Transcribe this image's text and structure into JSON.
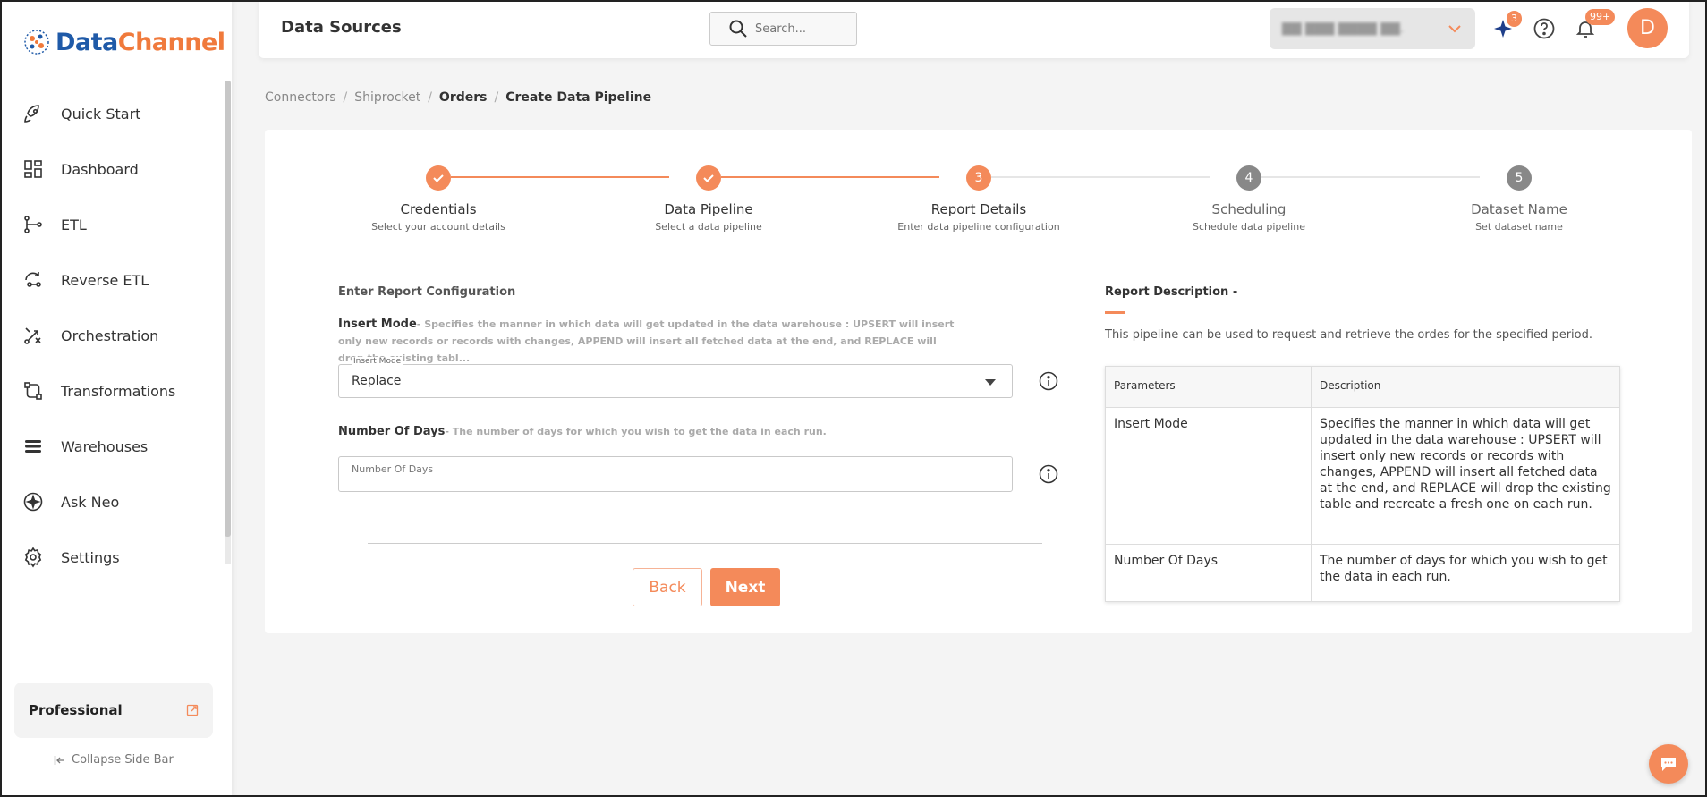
{
  "brand": {
    "name_part1": "Data",
    "name_part2": "Channel"
  },
  "sidebar": {
    "items": [
      {
        "label": "Quick Start",
        "icon": "rocket-icon"
      },
      {
        "label": "Dashboard",
        "icon": "dashboard-icon"
      },
      {
        "label": "ETL",
        "icon": "etl-icon"
      },
      {
        "label": "Reverse ETL",
        "icon": "reverse-etl-icon"
      },
      {
        "label": "Orchestration",
        "icon": "orchestration-icon"
      },
      {
        "label": "Transformations",
        "icon": "transformations-icon"
      },
      {
        "label": "Warehouses",
        "icon": "warehouses-icon"
      },
      {
        "label": "Ask Neo",
        "icon": "sparkle-icon"
      },
      {
        "label": "Settings",
        "icon": "gear-icon"
      }
    ],
    "plan_label": "Professional",
    "collapse_label": "Collapse Side Bar"
  },
  "header": {
    "title": "Data Sources",
    "search_placeholder": "Search...",
    "workspace_name": "▇▇ ▇▇▇ ▇▇▇▇ ▇▇.",
    "sparkle_badge": "3",
    "notification_badge": "99+",
    "avatar_initial": "D"
  },
  "breadcrumb": {
    "items": [
      "Connectors",
      "Shiprocket",
      "Orders",
      "Create Data Pipeline"
    ],
    "separator": "/"
  },
  "stepper": {
    "steps": [
      {
        "title": "Credentials",
        "subtitle": "Select your account details",
        "status": "done",
        "number": "1"
      },
      {
        "title": "Data Pipeline",
        "subtitle": "Select a data pipeline",
        "status": "done",
        "number": "2"
      },
      {
        "title": "Report Details",
        "subtitle": "Enter data pipeline configuration",
        "status": "active",
        "number": "3"
      },
      {
        "title": "Scheduling",
        "subtitle": "Schedule data pipeline",
        "status": "pending",
        "number": "4"
      },
      {
        "title": "Dataset Name",
        "subtitle": "Set dataset name",
        "status": "pending",
        "number": "5"
      }
    ]
  },
  "form": {
    "heading": "Enter Report Configuration",
    "insert_mode": {
      "label": "Insert Mode",
      "description": "- Specifies the manner in which data will get updated in the data warehouse : UPSERT will insert only new records or records with changes, APPEND will insert all fetched data at the end, and REPLACE will drop the existing tabl...",
      "floating_label": "Insert Mode",
      "value": "Replace"
    },
    "number_of_days": {
      "label": "Number Of Days",
      "description": "- The number of days for which you wish to get the data in each run.",
      "placeholder": "Number Of Days"
    },
    "back_label": "Back",
    "next_label": "Next"
  },
  "report_description": {
    "title": "Report Description -",
    "text": "This pipeline can be used to request and retrieve the ordes for the specified period.",
    "table": {
      "headers": [
        "Parameters",
        "Description"
      ],
      "rows": [
        {
          "param": "Insert Mode",
          "desc": "Specifies the manner in which data will get updated in the data warehouse : UPSERT will insert only new records or records with changes, APPEND will insert all fetched data at the end, and REPLACE will drop the existing table and recreate a fresh one on each run."
        },
        {
          "param": "Number Of Days",
          "desc": "The number of days for which you wish to get the data in each run."
        }
      ]
    }
  },
  "colors": {
    "accent": "#f48a5a",
    "brand_blue": "#1f5aa8",
    "pending": "#888888"
  }
}
